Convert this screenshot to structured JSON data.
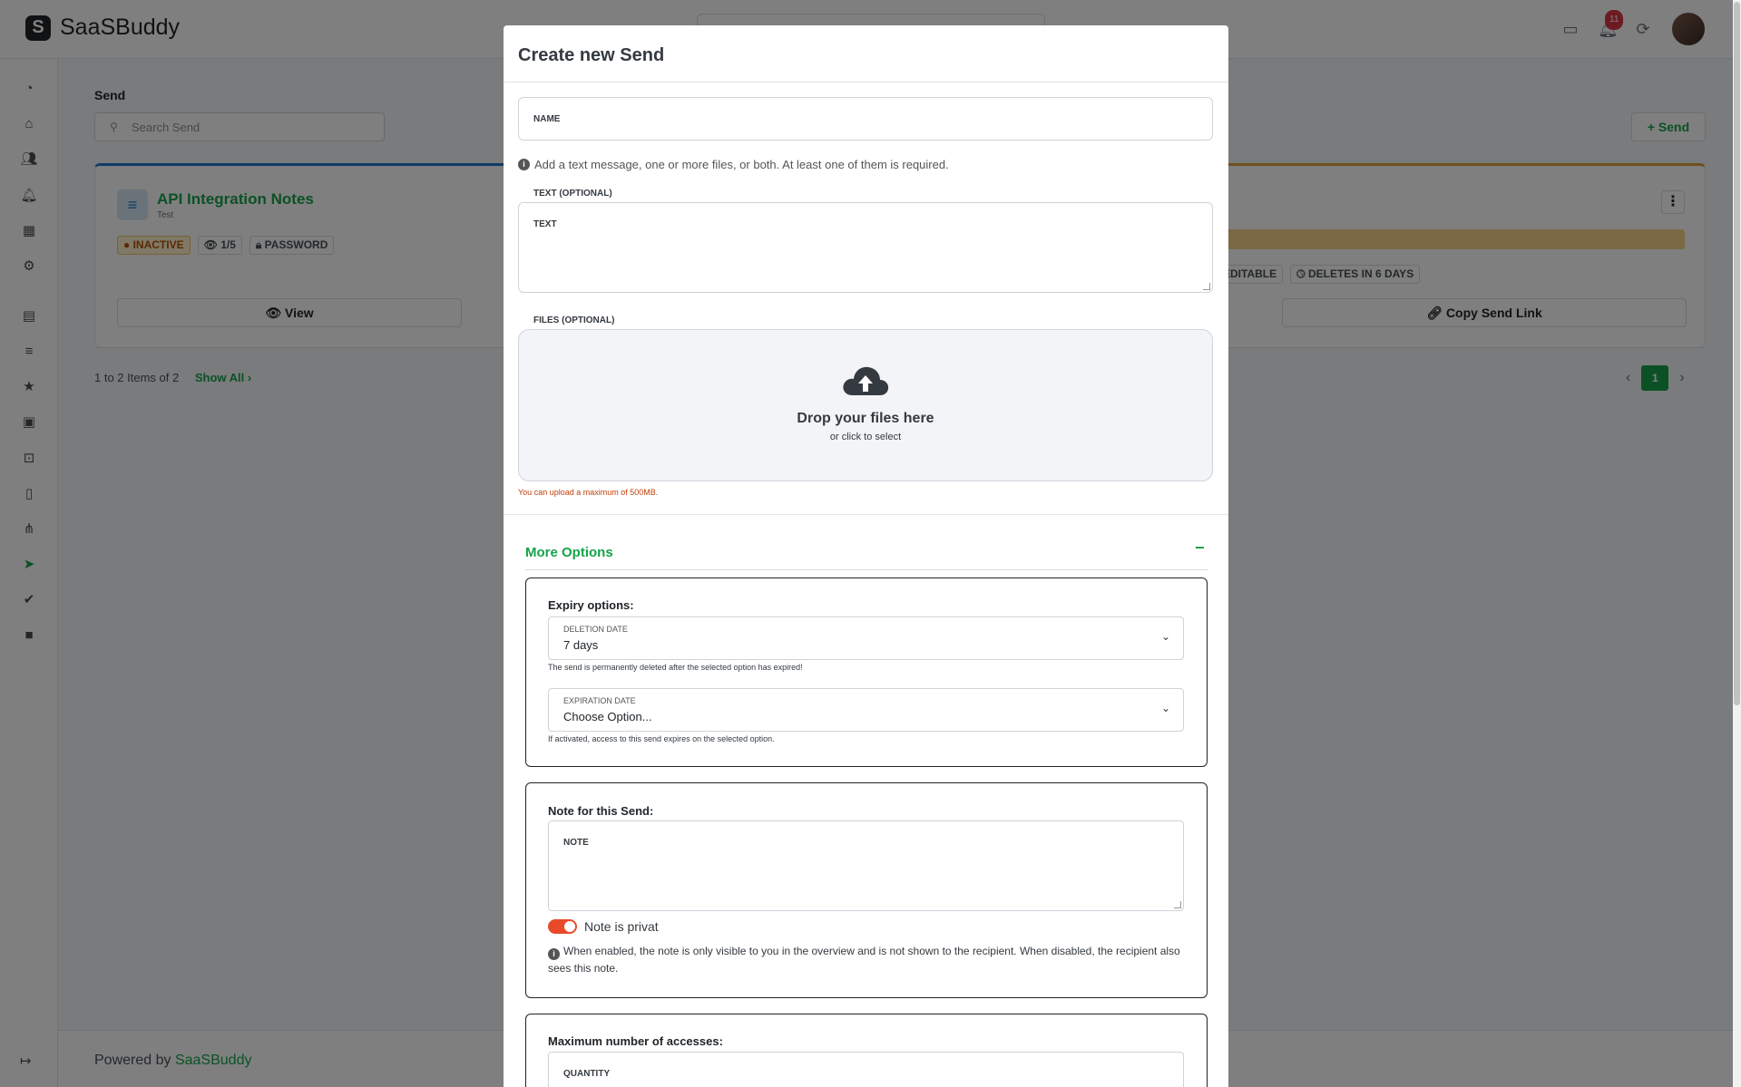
{
  "app": {
    "name": "SaaSBuddy",
    "notifications_count": "11"
  },
  "sidebar": {
    "icons": [
      "pie-chart-icon",
      "home-icon",
      "users-icon",
      "bell-icon",
      "calendar-icon",
      "cog-icon",
      "book-icon",
      "list-icon",
      "star-icon",
      "newspaper-icon",
      "gamepad-icon",
      "pdf-icon",
      "flow-icon",
      "send-icon",
      "check-double-icon",
      "video-icon"
    ],
    "active": "send-icon"
  },
  "page": {
    "title": "Send",
    "search_placeholder": "Search Send",
    "add_button": "Send",
    "card_left": {
      "title": "API Integration Notes",
      "subtitle": "Test",
      "badge_status": "INACTIVE",
      "badge_views": "1/5",
      "badge_password": "PASSWORD",
      "view_button": "View"
    },
    "card_right": {
      "badge_editable": "EDITABLE",
      "badge_deletes": "DELETES IN 6 DAYS",
      "copy_button": "Copy Send Link"
    },
    "pagination": {
      "info": "1 to 2 Items of 2",
      "show_all": "Show All",
      "current": "1"
    },
    "footer": {
      "prefix": "Powered by",
      "brand": "SaaSBuddy"
    }
  },
  "modal": {
    "title": "Create new Send",
    "name_label": "NAME",
    "info": "Add a text message, one or more files, or both. At least one of them is required.",
    "text_section_label": "TEXT (OPTIONAL)",
    "text_field_label": "TEXT",
    "files_section_label": "FILES (OPTIONAL)",
    "dropzone_title": "Drop your files here",
    "dropzone_sub": "or click to select",
    "upload_note": "You can upload a maximum of 500MB.",
    "more_options": "More Options",
    "more_toggle": "−",
    "expiry": {
      "title": "Expiry options:",
      "deletion_label": "DELETION DATE",
      "deletion_value": "7 days",
      "deletion_hint": "The send is permanently deleted after the selected option has expired!",
      "expiration_label": "EXPIRATION DATE",
      "expiration_value": "Choose Option...",
      "expiration_hint": "If activated, access to this send expires on the selected option."
    },
    "note": {
      "title": "Note for this Send:",
      "field_label": "NOTE",
      "toggle_label": "Note is privat",
      "toggle_on": true,
      "info": "When enabled, the note is only visible to you in the overview and is not shown to the recipient. When disabled, the recipient also sees this note."
    },
    "access": {
      "title": "Maximum number of accesses:",
      "quantity_label": "QUANTITY"
    }
  },
  "colors": {
    "accent": "#16a34a",
    "danger": "#dc3545",
    "toggle": "#e84a2a"
  }
}
